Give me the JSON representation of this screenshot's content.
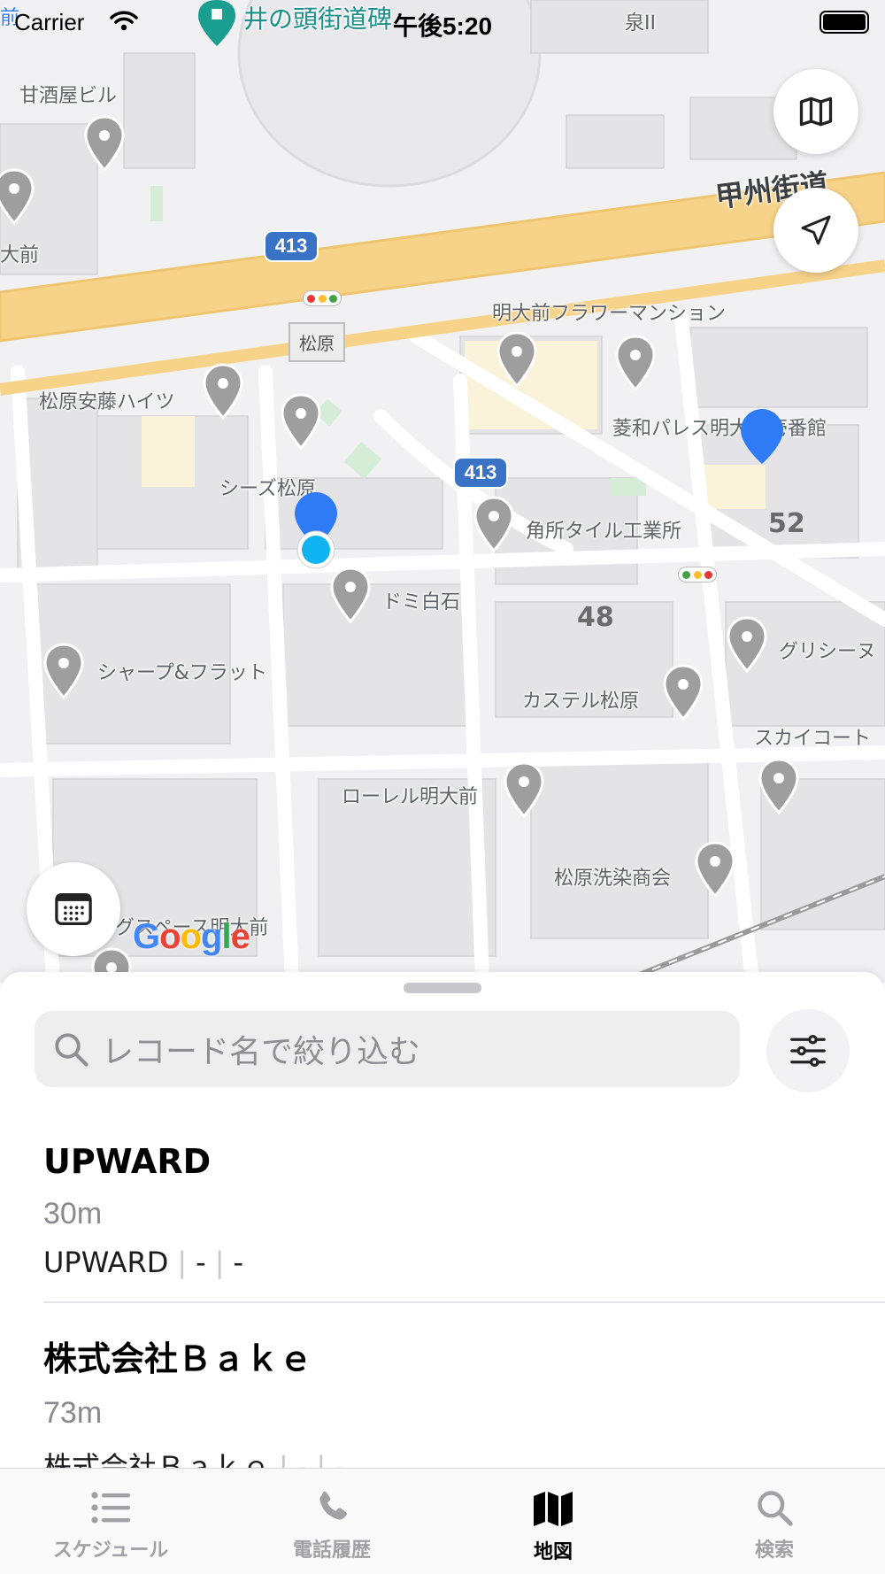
{
  "status_bar": {
    "carrier": "Carrier",
    "time": "午後5:20"
  },
  "map": {
    "labels": [
      "井の頭街道碑",
      "泉II",
      "甘酒屋ビル",
      "大前",
      "甲州街道",
      "明大前フラワーマンション",
      "松原安藤ハイツ",
      "菱和パレス明大前壱番館",
      "シーズ松原",
      "角所タイル工業所",
      "ドミ白石",
      "シャープ&フラット",
      "カステル松原",
      "グリシーヌ",
      "スカイコート",
      "ローレル明大前",
      "松原洗染商会",
      "グスペース明大前",
      "前"
    ],
    "block_numbers": [
      "52",
      "48"
    ],
    "route_shields": [
      "413",
      "413"
    ],
    "station": "松原",
    "attribution": "Google"
  },
  "controls": {
    "map_type_icon": "map-icon",
    "locate_icon": "location-arrow-icon",
    "calendar_icon": "calendar-icon"
  },
  "sheet": {
    "search_placeholder": "レコード名で絞り込む",
    "records": [
      {
        "name": "UPWARD",
        "distance": "30m",
        "sub": [
          "UPWARD",
          "-",
          "-"
        ]
      },
      {
        "name": "株式会社Ｂａｋｅ",
        "distance": "73m",
        "sub": [
          "株式会社Ｂａｋｅ",
          "-",
          "-"
        ]
      }
    ]
  },
  "tabs": [
    {
      "label": "スケジュール",
      "icon": "list-icon",
      "active": false
    },
    {
      "label": "電話履歴",
      "icon": "phone-icon",
      "active": false
    },
    {
      "label": "地図",
      "icon": "map-icon",
      "active": true
    },
    {
      "label": "検索",
      "icon": "search-icon",
      "active": false
    }
  ],
  "colors": {
    "accent": "#2f7bf5",
    "user_location": "#0fb4f0",
    "highway": "#f7d38a",
    "route_shield": "#3a73c6"
  }
}
